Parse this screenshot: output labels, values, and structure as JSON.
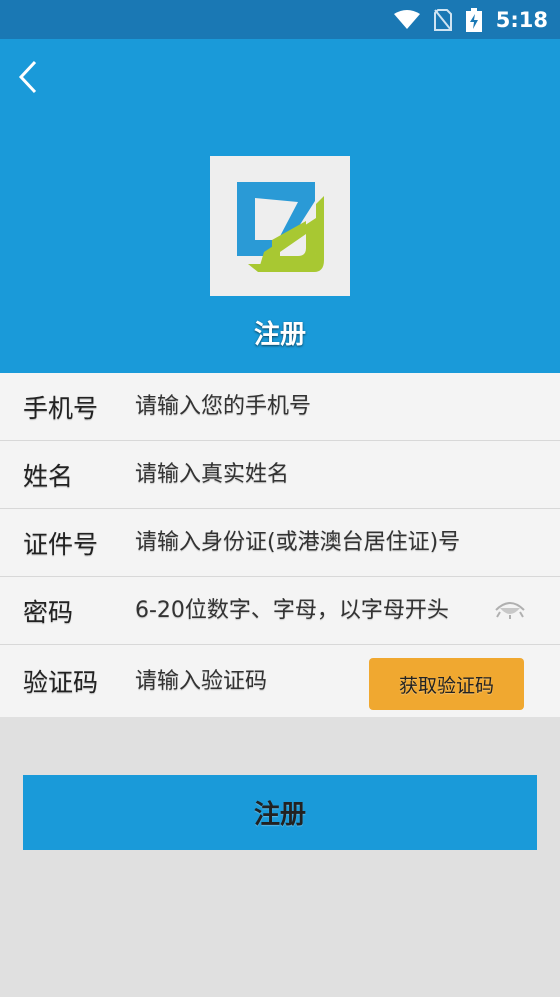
{
  "status_bar": {
    "time": "5:18",
    "icons": [
      "wifi-icon",
      "no-sim-icon",
      "battery-charging-icon"
    ]
  },
  "header": {
    "title": "注册",
    "back_icon": "chevron-left-icon",
    "colors": {
      "background": "#1a9ad9",
      "status_bar": "#1a78b4"
    }
  },
  "form": {
    "phone": {
      "label": "手机号",
      "placeholder": "请输入您的手机号"
    },
    "name": {
      "label": "姓名",
      "placeholder": "请输入真实姓名"
    },
    "id_number": {
      "label": "证件号",
      "placeholder": "请输入身份证(或港澳台居住证)号"
    },
    "password": {
      "label": "密码",
      "placeholder": "6-20位数字、字母，以字母开头",
      "toggle_icon": "eye-icon"
    },
    "verify_code": {
      "label": "验证码",
      "placeholder": "请输入验证码",
      "button_label": "获取验证码",
      "button_color": "#f0a830"
    }
  },
  "submit": {
    "label": "注册"
  }
}
